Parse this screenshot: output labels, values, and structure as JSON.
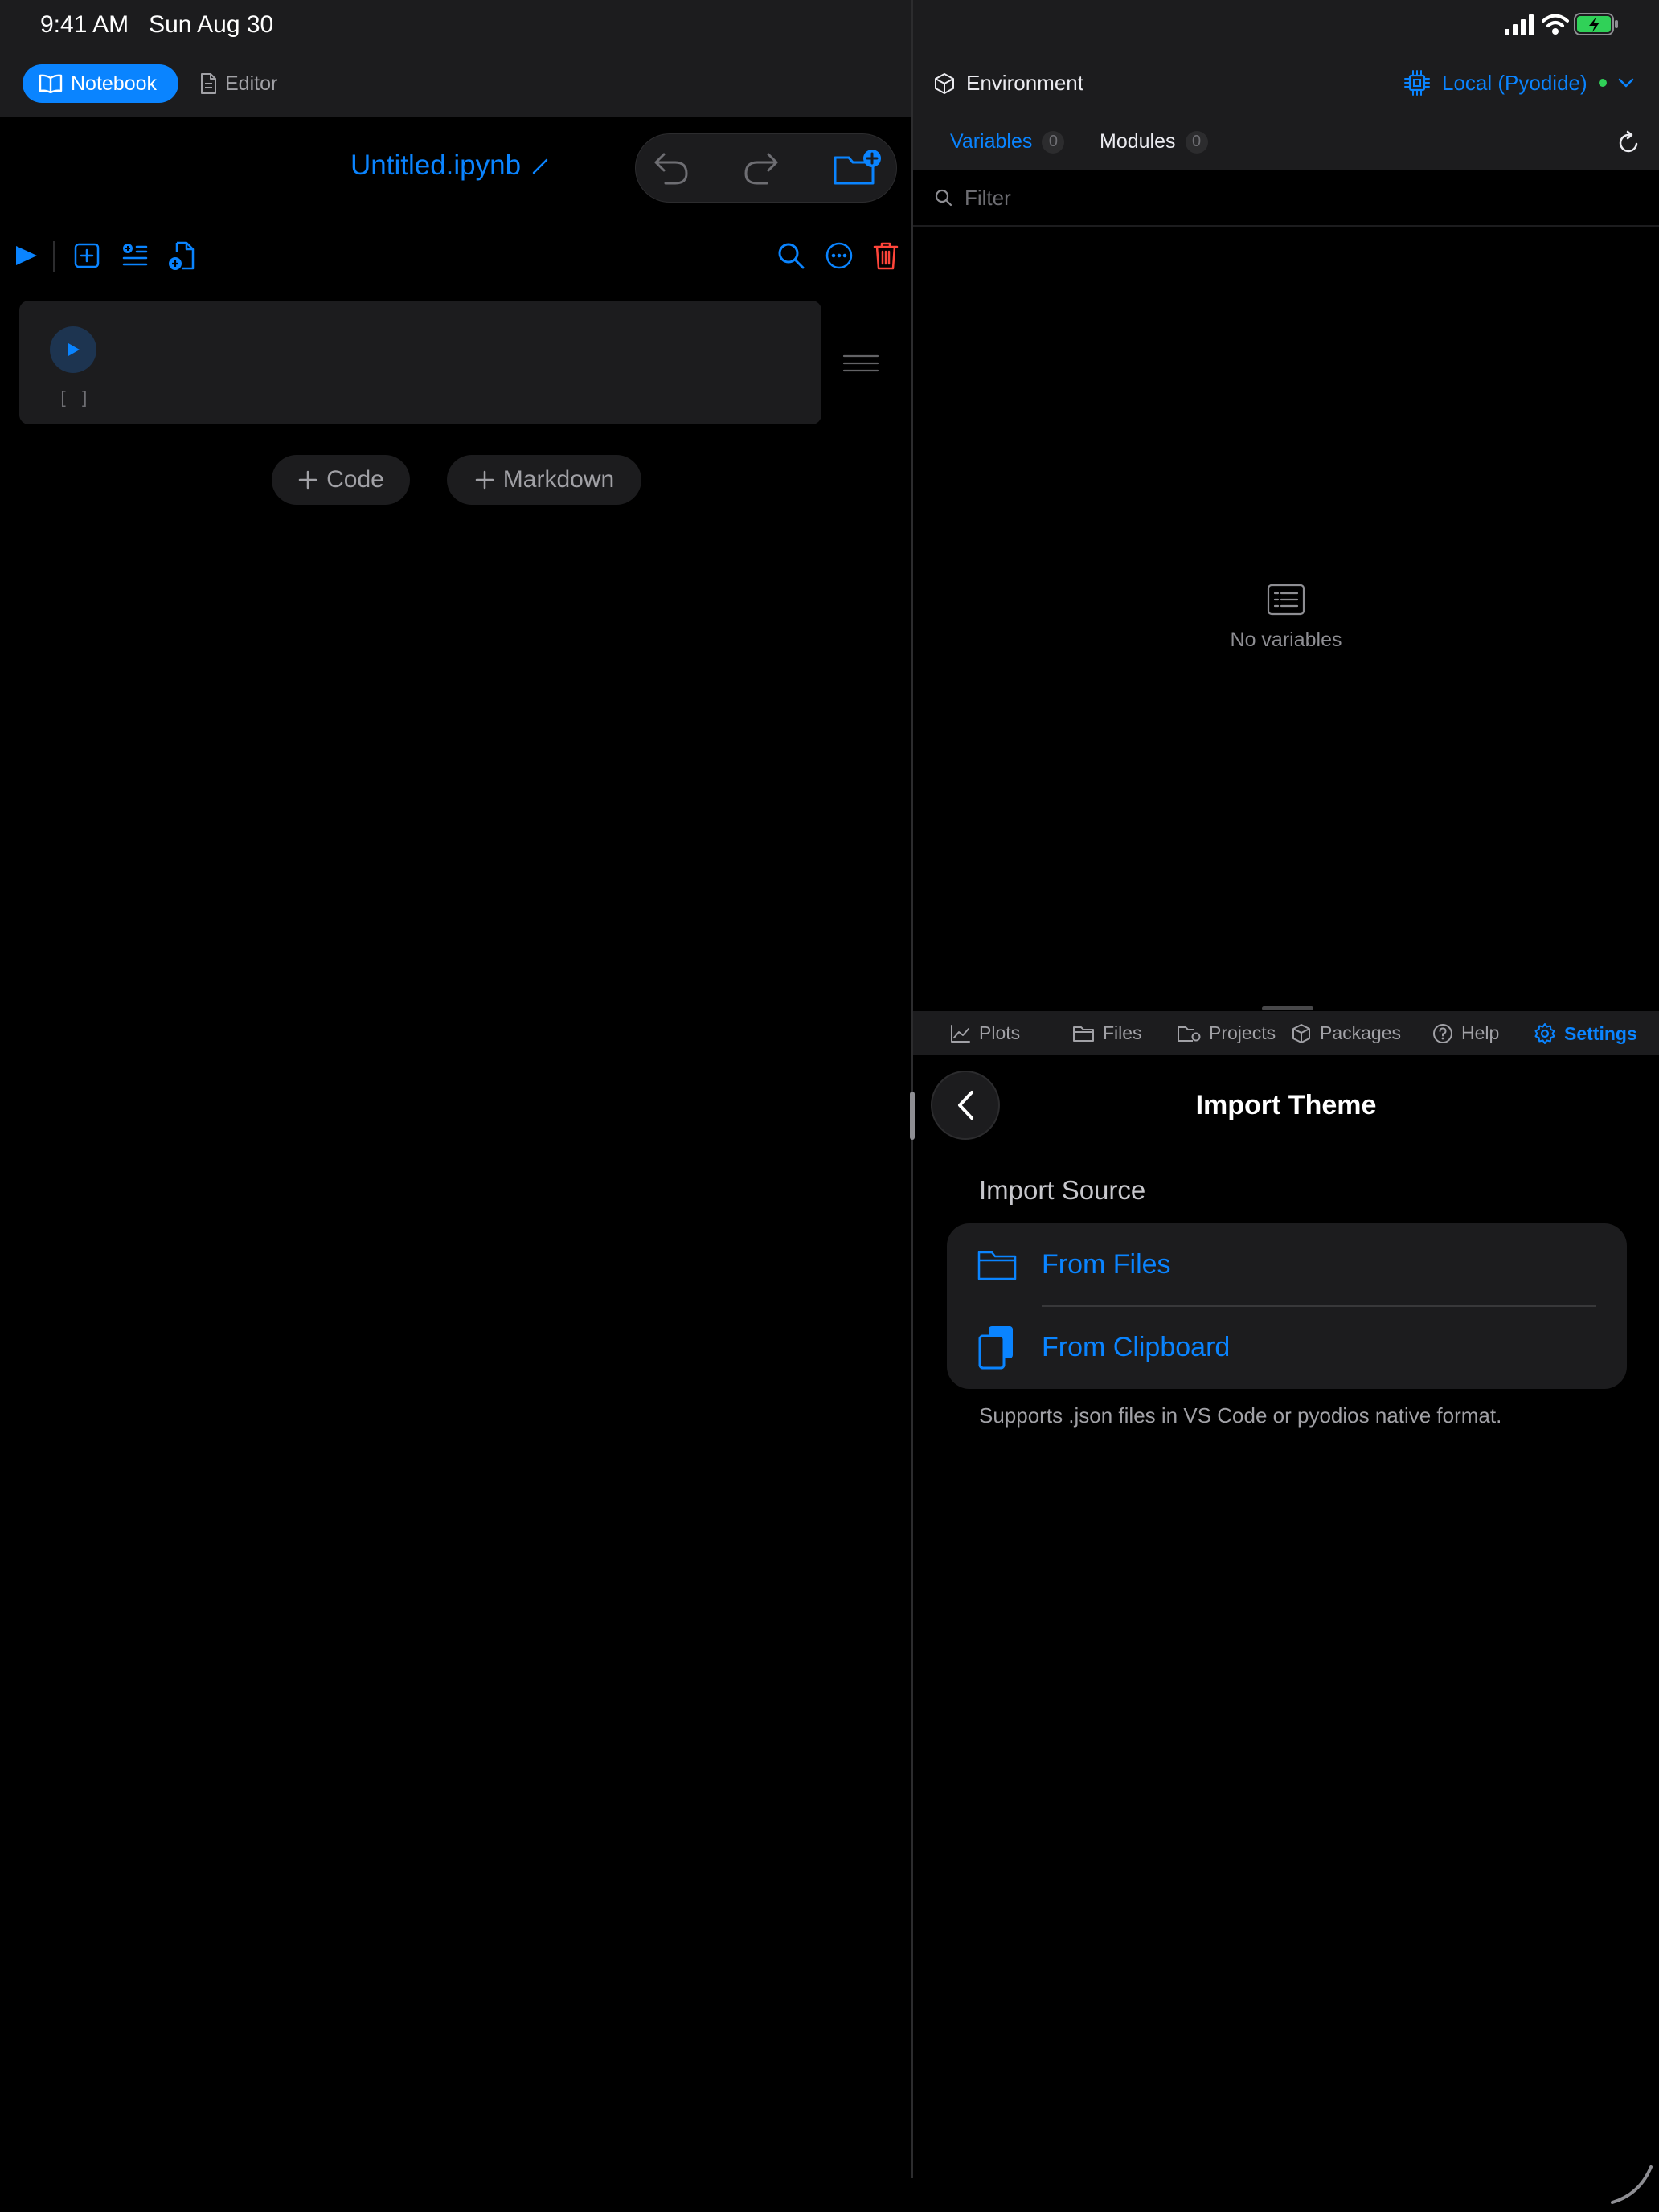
{
  "status_bar": {
    "time": "9:41 AM",
    "date": "Sun Aug 30"
  },
  "mode_tabs": {
    "notebook": "Notebook",
    "editor": "Editor"
  },
  "notebook": {
    "title": "Untitled.ipynb",
    "cell_prompt": "[ ]",
    "add_code": "Code",
    "add_markdown": "Markdown"
  },
  "environment": {
    "label": "Environment",
    "runtime": "Local (Pyodide)",
    "tabs": {
      "variables": {
        "label": "Variables",
        "count": "0"
      },
      "modules": {
        "label": "Modules",
        "count": "0"
      }
    },
    "filter_placeholder": "Filter",
    "empty_text": "No variables"
  },
  "panel_tabs": {
    "plots": "Plots",
    "files": "Files",
    "projects": "Projects",
    "packages": "Packages",
    "help": "Help",
    "settings": "Settings"
  },
  "import_theme": {
    "title": "Import Theme",
    "section": "Import Source",
    "from_files": "From Files",
    "from_clipboard": "From Clipboard",
    "note": "Supports .json files in VS Code or pyodios native format."
  },
  "colors": {
    "accent": "#0a84ff",
    "danger": "#ff453a",
    "online": "#30d158",
    "battery": "#30d158"
  }
}
